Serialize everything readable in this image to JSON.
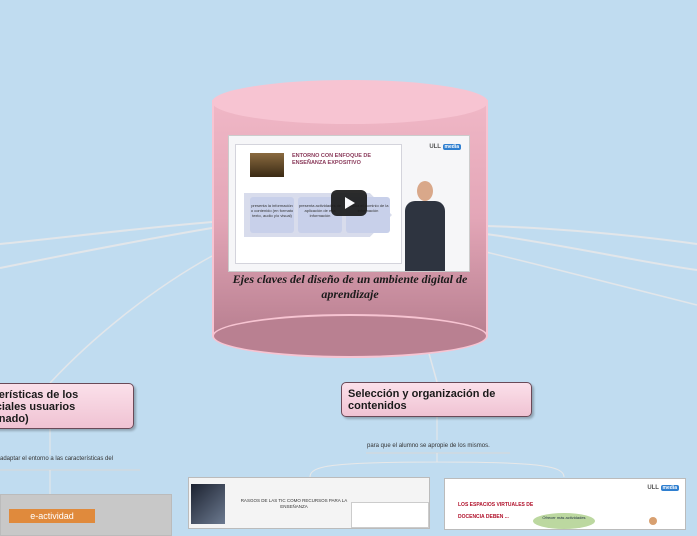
{
  "central": {
    "title": "Ejes claves del diseño de un ambiente digital de aprendizaje",
    "video": {
      "slide_title": "ENTORNO CON ENFOQUE DE ENSEÑANZA EXPOSITIVO",
      "box1": "presenta la información o contenido (en formato texto, audio y/o visual)",
      "box2": "presenta actividades de aplicación de esa información",
      "box3": "evalúa el dominio de la información",
      "logo_text": "ULL",
      "logo_badge": "media"
    }
  },
  "nodes": {
    "left": {
      "line1": "cterísticas de los",
      "line2": "nciales usuarios",
      "line3": "mnado)",
      "note": "adaptar el entorno a las características del",
      "thumb_label": "e-actividad"
    },
    "right": {
      "title": "Selección y organización de contenidos",
      "note": "para que el alumno se apropie de los mismos.",
      "thumb1_text": "RASGOS DE LAS TIC COMO RECURSOS PARA LA ENSEÑANZA",
      "thumb2_title": "LOS ESPACIOS VIRTUALES DE DOCENCIA DEBEN ...",
      "thumb2_ellipse": "Ofrecer más actividades",
      "thumb2_logo": "ULL",
      "thumb2_badge": "media"
    }
  },
  "colors": {
    "background": "#c0dcf0",
    "central_pink": "#f0b7c6",
    "node_pink": "#f0c3d3",
    "connector": "#d8d8d8"
  }
}
